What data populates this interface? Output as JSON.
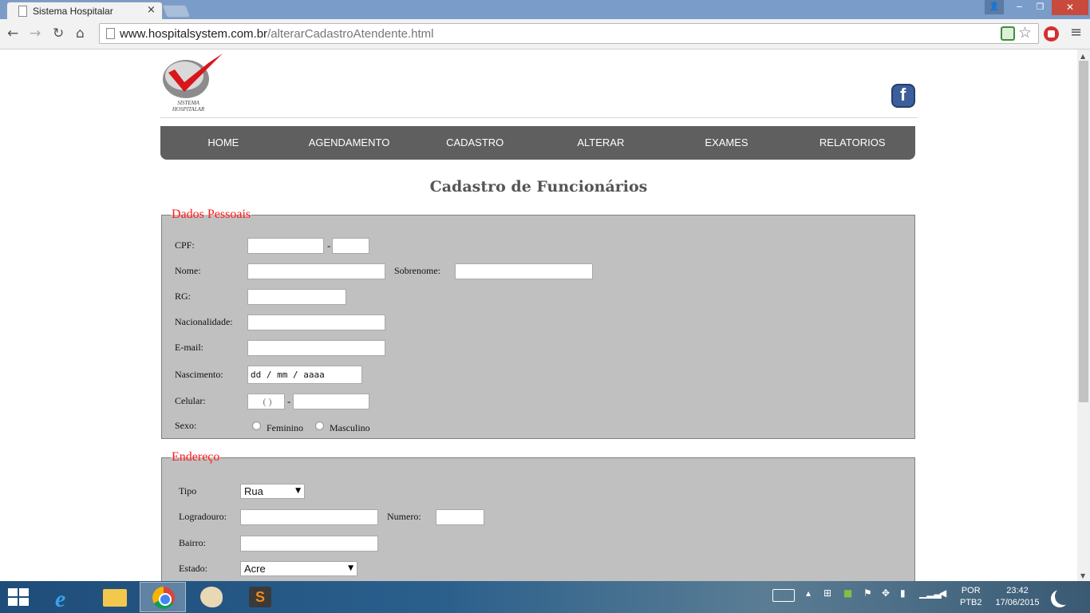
{
  "browser": {
    "tab_title": "Sistema Hospitalar",
    "tab_close": "×",
    "url_domain": "www.hospitalsystem.com.br",
    "url_path": "/alterarCadastroAtendente.html",
    "back": "←",
    "forward": "→",
    "reload": "↻",
    "home": "⌂",
    "star": "☆",
    "menu": "≡",
    "win_user": "👤",
    "win_minimize": "−",
    "win_restore": "❐",
    "win_close": "✕"
  },
  "header": {
    "logo_text_1": "SISTEMA",
    "logo_text_2": "HOSPITALAR"
  },
  "nav": {
    "items": [
      "HOME",
      "AGENDAMENTO",
      "CADASTRO",
      "ALTERAR",
      "EXAMES",
      "RELATORIOS"
    ]
  },
  "page": {
    "title": "Cadastro de Funcionários"
  },
  "dados_pessoais": {
    "legend": "Dados Pessoais",
    "cpf_label": "CPF:",
    "cpf_dash": "-",
    "nome_label": "Nome:",
    "sobrenome_label": "Sobrenome:",
    "rg_label": "RG:",
    "nacionalidade_label": "Nacionalidade:",
    "email_label": "E-mail:",
    "nascimento_label": "Nascimento:",
    "nascimento_value": "dd / mm / aaaa",
    "celular_label": "Celular:",
    "celular_ddd": "(   )",
    "celular_dash": "-",
    "sexo_label": "Sexo:",
    "sexo_options": [
      "Feminino",
      "Masculino"
    ]
  },
  "endereco": {
    "legend": "Endereço",
    "tipo_label": "Tipo",
    "tipo_value": "Rua",
    "logradouro_label": "Logradouro:",
    "numero_label": "Numero:",
    "bairro_label": "Bairro:",
    "estado_label": "Estado:",
    "estado_value": "Acre",
    "select_arrow": "▼"
  },
  "taskbar": {
    "lang_1": "POR",
    "lang_2": "PTB2",
    "time": "23:42",
    "date": "17/06/2015"
  }
}
